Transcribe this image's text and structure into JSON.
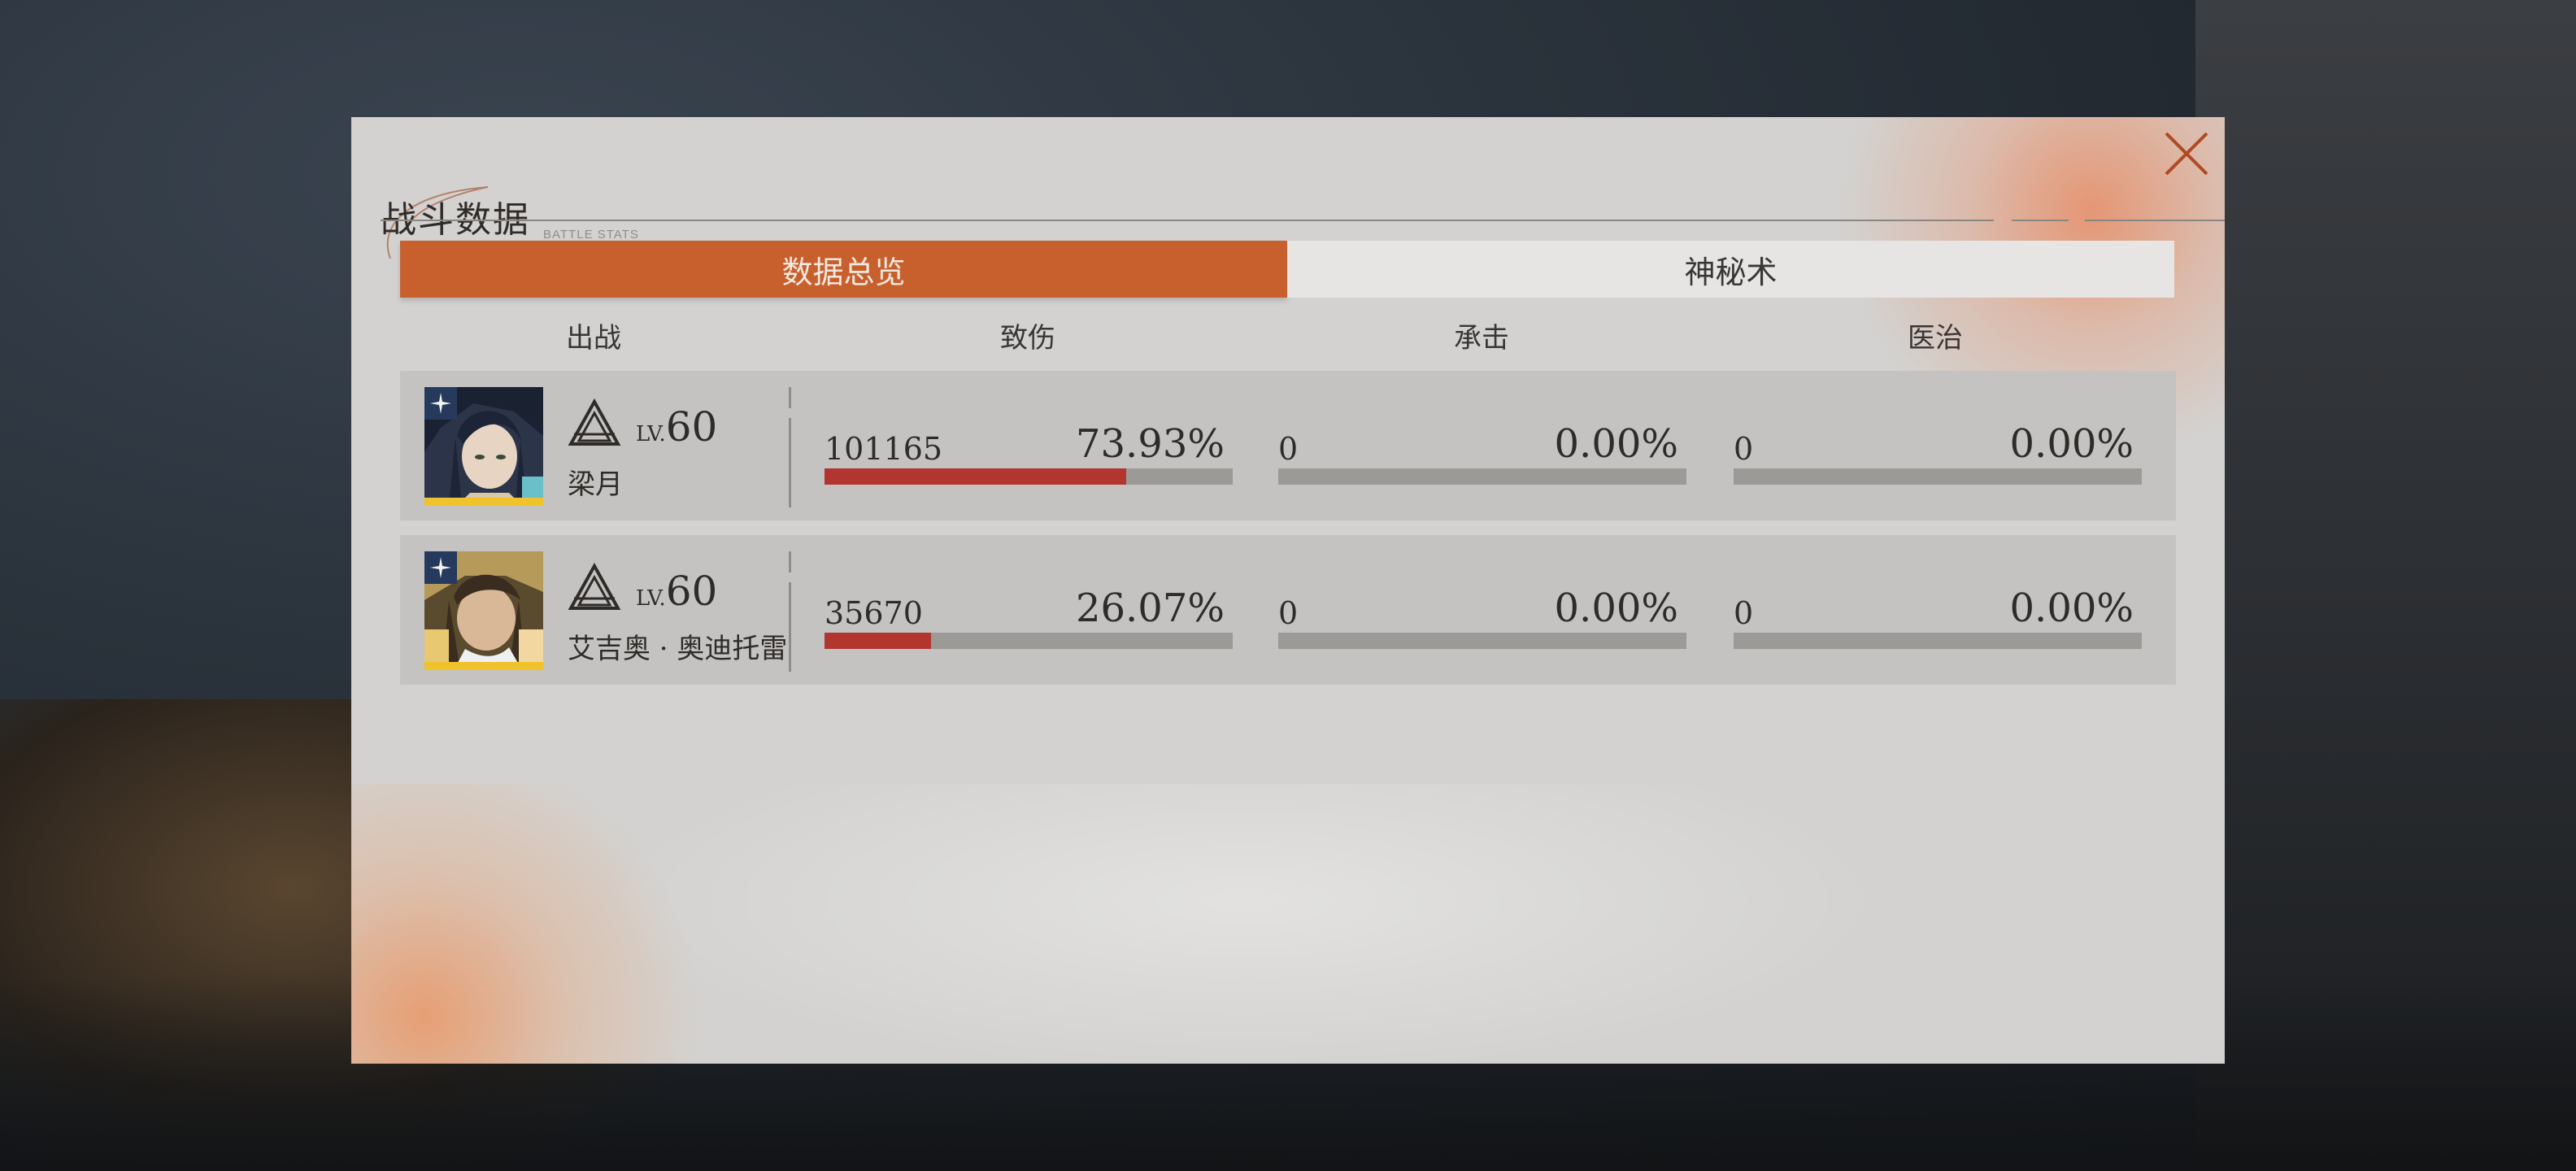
{
  "panel": {
    "title": "战斗数据",
    "subtitle": "BATTLE STATS"
  },
  "tabs": [
    {
      "label": "数据总览",
      "active": true
    },
    {
      "label": "神秘术",
      "active": false
    }
  ],
  "columns": [
    "出战",
    "致伤",
    "承击",
    "医治"
  ],
  "rows": [
    {
      "name": "梁月",
      "level_prefix": "LV.",
      "level": "60",
      "damage": {
        "value": "101165",
        "percent": "73.93%",
        "fill": 0.7393
      },
      "taken": {
        "value": "0",
        "percent": "0.00%",
        "fill": 0
      },
      "healing": {
        "value": "0",
        "percent": "0.00%",
        "fill": 0
      }
    },
    {
      "name": "艾吉奥 · 奥迪托雷",
      "level_prefix": "LV.",
      "level": "60",
      "damage": {
        "value": "35670",
        "percent": "26.07%",
        "fill": 0.2607
      },
      "taken": {
        "value": "0",
        "percent": "0.00%",
        "fill": 0
      },
      "healing": {
        "value": "0",
        "percent": "0.00%",
        "fill": 0
      }
    }
  ],
  "colors": {
    "accent": "#c8602e",
    "damage_fill": "#b2352f",
    "bar_track": "#9b9a97",
    "panel_bg": "#d3d2d0"
  },
  "icons": {
    "close": "close-icon",
    "rank": "rank-triangle-icon",
    "badge": "compass-star-icon"
  }
}
